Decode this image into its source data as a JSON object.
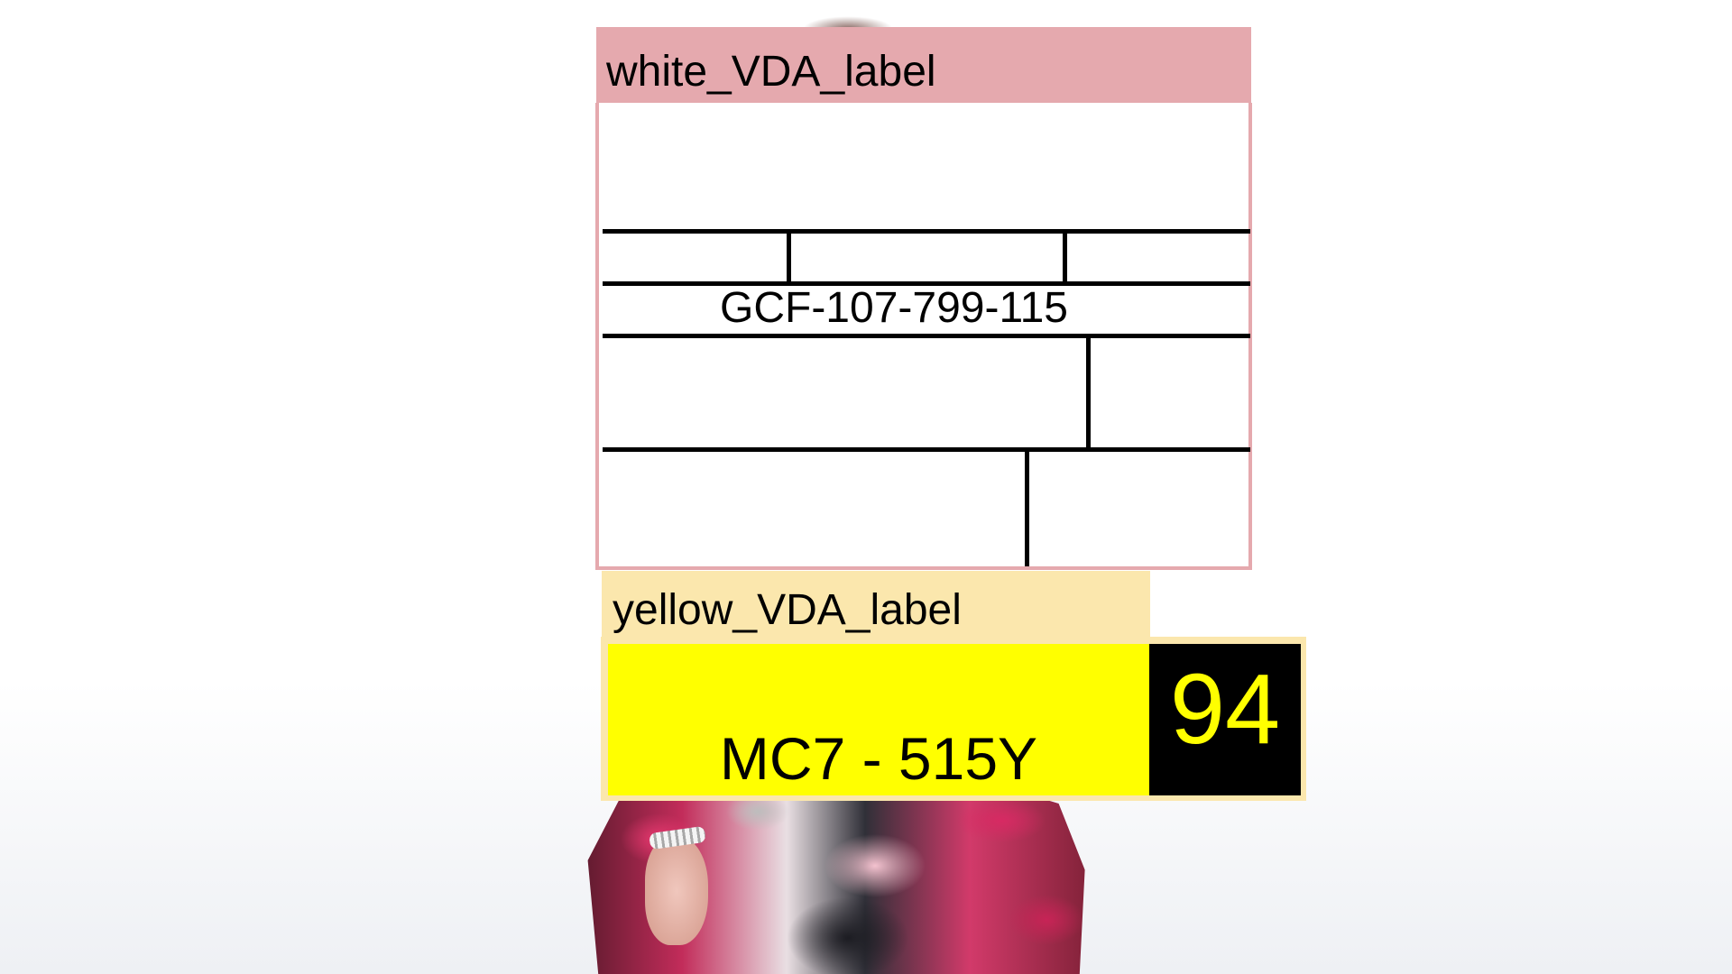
{
  "white_label": {
    "tag": "white_VDA_label",
    "code": "GCF-107-799-115",
    "tag_color": "#e5a9ae"
  },
  "yellow_label": {
    "tag": "yellow_VDA_label",
    "plate": "MC7 - 515Y",
    "number": "94",
    "tag_color": "#fbe7ad",
    "body_color": "#ffff00",
    "number_color": "#ffff00"
  }
}
